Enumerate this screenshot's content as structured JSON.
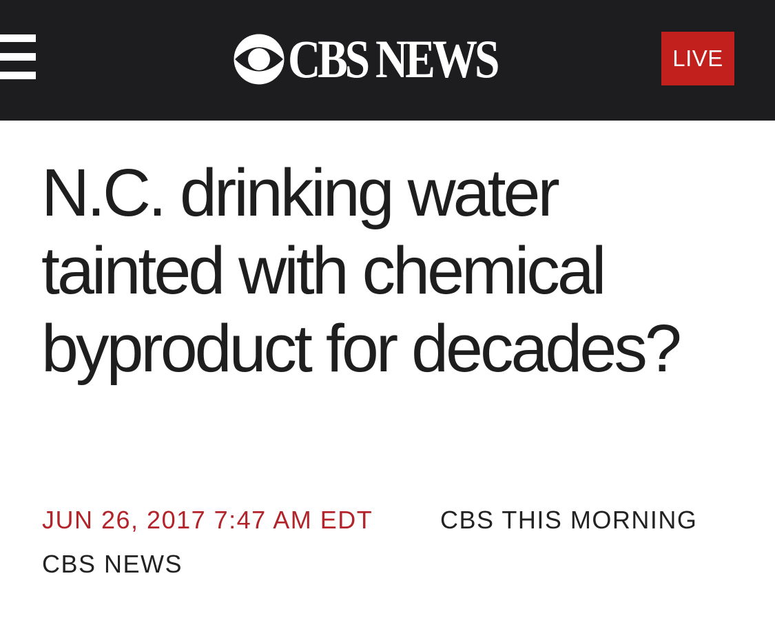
{
  "header": {
    "menu_icon": "hamburger-menu-icon",
    "logo_icon": "cbs-eye-logo-icon",
    "logo_text": "CBS NEWS",
    "live_label": "LIVE",
    "background_color": "#1d1d1f",
    "live_color": "#c1201d"
  },
  "article": {
    "headline": "N.C. drinking water tainted with chemical byproduct for decades?",
    "date": "JUN 26, 2017 7:47 AM EDT",
    "show": "CBS THIS MORNING",
    "source": "CBS NEWS",
    "date_color": "#b3232a"
  }
}
